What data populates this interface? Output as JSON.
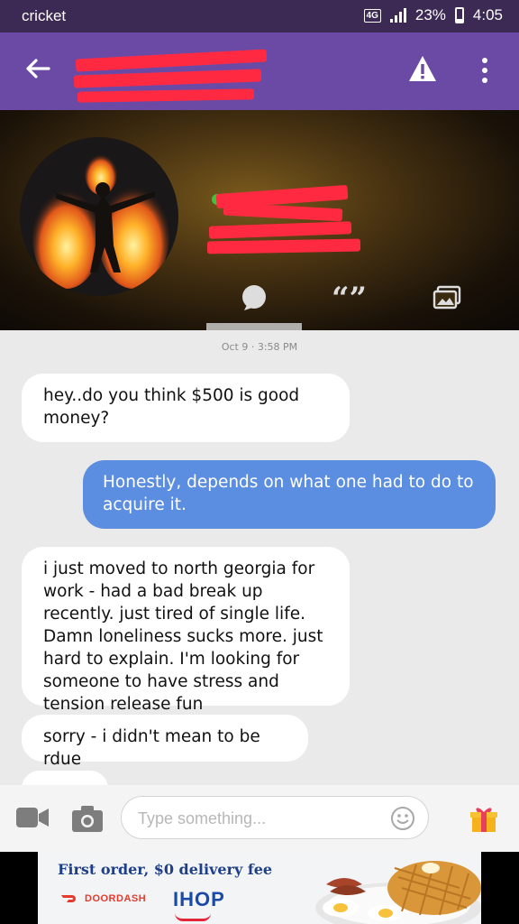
{
  "status_bar": {
    "carrier": "cricket",
    "network": "4G",
    "battery": "23%",
    "time": "4:05"
  },
  "app_bar": {
    "contact_name": "[redacted]"
  },
  "profile": {
    "name": "[redacted]",
    "status": "[redacted]"
  },
  "chat": {
    "timestamp": "Oct 9 · 3:58 PM",
    "messages": [
      {
        "direction": "in",
        "text": "hey..do you think $500 is good money?"
      },
      {
        "direction": "out",
        "text": "Honestly, depends on what one had to do to acquire it."
      },
      {
        "direction": "in",
        "text": "i just moved to north georgia for work - had a bad break up recently. just tired of single life. Damn loneliness sucks more. just hard to explain. I'm looking for someone to have stress and tension release fun"
      },
      {
        "direction": "in",
        "text": "sorry - i didn't mean to be rdue"
      }
    ]
  },
  "composer": {
    "placeholder": "Type something..."
  },
  "ad": {
    "headline": "First order, $0 delivery fee",
    "brand1": "DOORDASH",
    "brand2": "IHOP"
  },
  "colors": {
    "app_bar": "#6a4aa5",
    "status_bar": "#3c2a55",
    "outgoing_bubble": "#5b8de0",
    "redaction": "#ff2a42"
  }
}
